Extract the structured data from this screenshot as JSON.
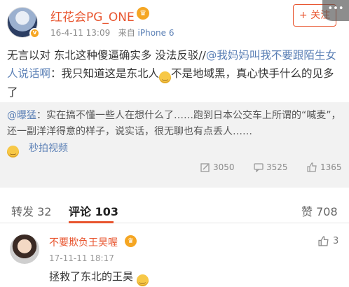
{
  "post": {
    "username": "红花会PG_ONE",
    "date": "16-4-11 13:09",
    "source_prefix": "来自",
    "source": "iPhone 6",
    "follow_label": "+ 关注",
    "text_part1": "无言以对 东北这种傻逼确实多 没法反驳//",
    "mention": "@我妈妈叫我不要跟陌生女人说话啊",
    "text_part2": "：我只知道这是东北人",
    "text_part3": "不是地域黑，真心快手什么的见多了"
  },
  "repost": {
    "mention": "@曝猛",
    "text": "：实在搞不懂一些人在想什么了……跑到日本公交车上所谓的“喊麦”，还一副洋洋得意的样子，说实话，很无聊也有点丢人……",
    "video_label": "秒拍视频",
    "reposts": "3050",
    "comments": "3525",
    "likes": "1365"
  },
  "tabs": {
    "repost_label": "转发 32",
    "comment_label": "评论 103",
    "like_label": "赞 708"
  },
  "comment": {
    "username": "不要欺负王昊喔",
    "time": "17-11-11 18:17",
    "text": "拯救了东北的王昊",
    "likes": "3"
  },
  "icons": {
    "verified": "verified-badge-icon",
    "vip": "vip-crown-icon",
    "emoji": "emoji-face-icon",
    "repost": "repost-icon",
    "comment": "comment-icon",
    "like": "thumbs-up-icon",
    "more": "more-dots-icon"
  },
  "colors": {
    "accent": "#e8552f",
    "link": "#5a7fb5",
    "repost_bg": "#f2f2f2"
  }
}
